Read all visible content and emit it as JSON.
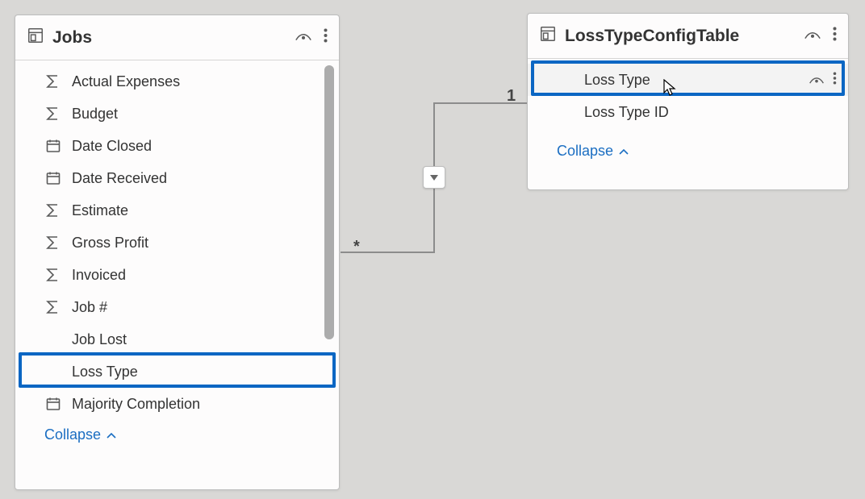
{
  "jobs": {
    "title": "Jobs",
    "fields": [
      {
        "label": "Actual Expenses",
        "icon": "sigma"
      },
      {
        "label": "Budget",
        "icon": "sigma"
      },
      {
        "label": "Date Closed",
        "icon": "calendar"
      },
      {
        "label": "Date Received",
        "icon": "calendar"
      },
      {
        "label": "Estimate",
        "icon": "sigma"
      },
      {
        "label": "Gross Profit",
        "icon": "sigma"
      },
      {
        "label": "Invoiced",
        "icon": "sigma"
      },
      {
        "label": "Job #",
        "icon": "sigma"
      },
      {
        "label": "Job Lost",
        "icon": "none"
      },
      {
        "label": "Loss Type",
        "icon": "none"
      },
      {
        "label": "Majority Completion",
        "icon": "calendar"
      }
    ],
    "collapse_label": "Collapse"
  },
  "ltct": {
    "title": "LossTypeConfigTable",
    "fields": [
      {
        "label": "Loss Type",
        "icon": "none"
      },
      {
        "label": "Loss Type ID",
        "icon": "none"
      }
    ],
    "collapse_label": "Collapse"
  },
  "relationship": {
    "left_cardinality": "*",
    "right_cardinality": "1"
  }
}
